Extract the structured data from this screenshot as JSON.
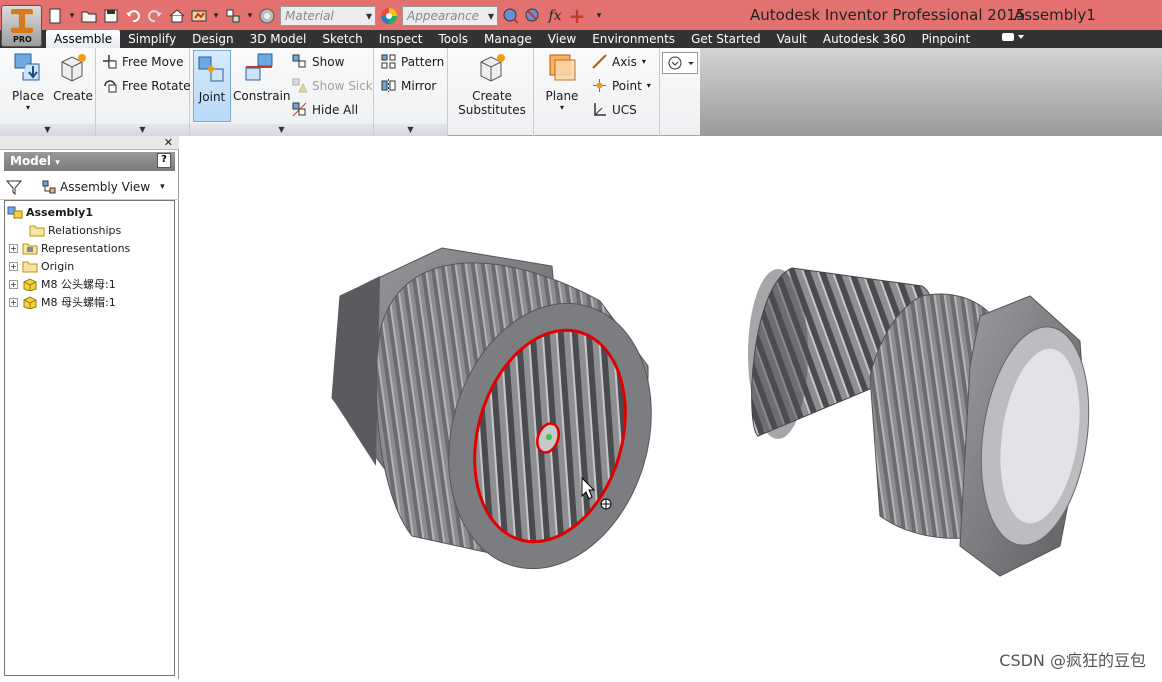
{
  "window": {
    "title": "Autodesk Inventor Professional 2015",
    "document": "Assembly1"
  },
  "app_button": {
    "label": "PRO"
  },
  "quick_access": {
    "material_placeholder": "Material",
    "appearance_placeholder": "Appearance",
    "fx": "fx"
  },
  "tabs": [
    {
      "label": "Assemble",
      "active": true
    },
    {
      "label": "Simplify"
    },
    {
      "label": "Design"
    },
    {
      "label": "3D Model"
    },
    {
      "label": "Sketch"
    },
    {
      "label": "Inspect"
    },
    {
      "label": "Tools"
    },
    {
      "label": "Manage"
    },
    {
      "label": "View"
    },
    {
      "label": "Environments"
    },
    {
      "label": "Get Started"
    },
    {
      "label": "Vault"
    },
    {
      "label": "Autodesk 360"
    },
    {
      "label": "Pinpoint"
    }
  ],
  "ribbon": {
    "place": "Place",
    "create": "Create",
    "free_move": "Free Move",
    "free_rotate": "Free Rotate",
    "joint": "Joint",
    "constrain": "Constrain",
    "show": "Show",
    "show_sick": "Show Sick",
    "hide_all": "Hide All",
    "pattern": "Pattern",
    "mirror": "Mirror",
    "create_substitutes_1": "Create",
    "create_substitutes_2": "Substitutes",
    "plane": "Plane",
    "axis": "Axis",
    "point": "Point",
    "ucs": "UCS"
  },
  "browser": {
    "header": "Model",
    "view_selector": "Assembly View",
    "tree": [
      {
        "label": "Assembly1"
      },
      {
        "label": "Relationships"
      },
      {
        "label": "Representations"
      },
      {
        "label": "Origin"
      },
      {
        "label": "M8 公头螺母:1"
      },
      {
        "label": "M8 母头螺帽:1"
      }
    ]
  },
  "watermark": "CSDN @疯狂的豆包",
  "colors": {
    "titlebar": "#e37170",
    "tabbar": "#333333",
    "selection": "#e00000",
    "part": "#8a8b8e"
  }
}
